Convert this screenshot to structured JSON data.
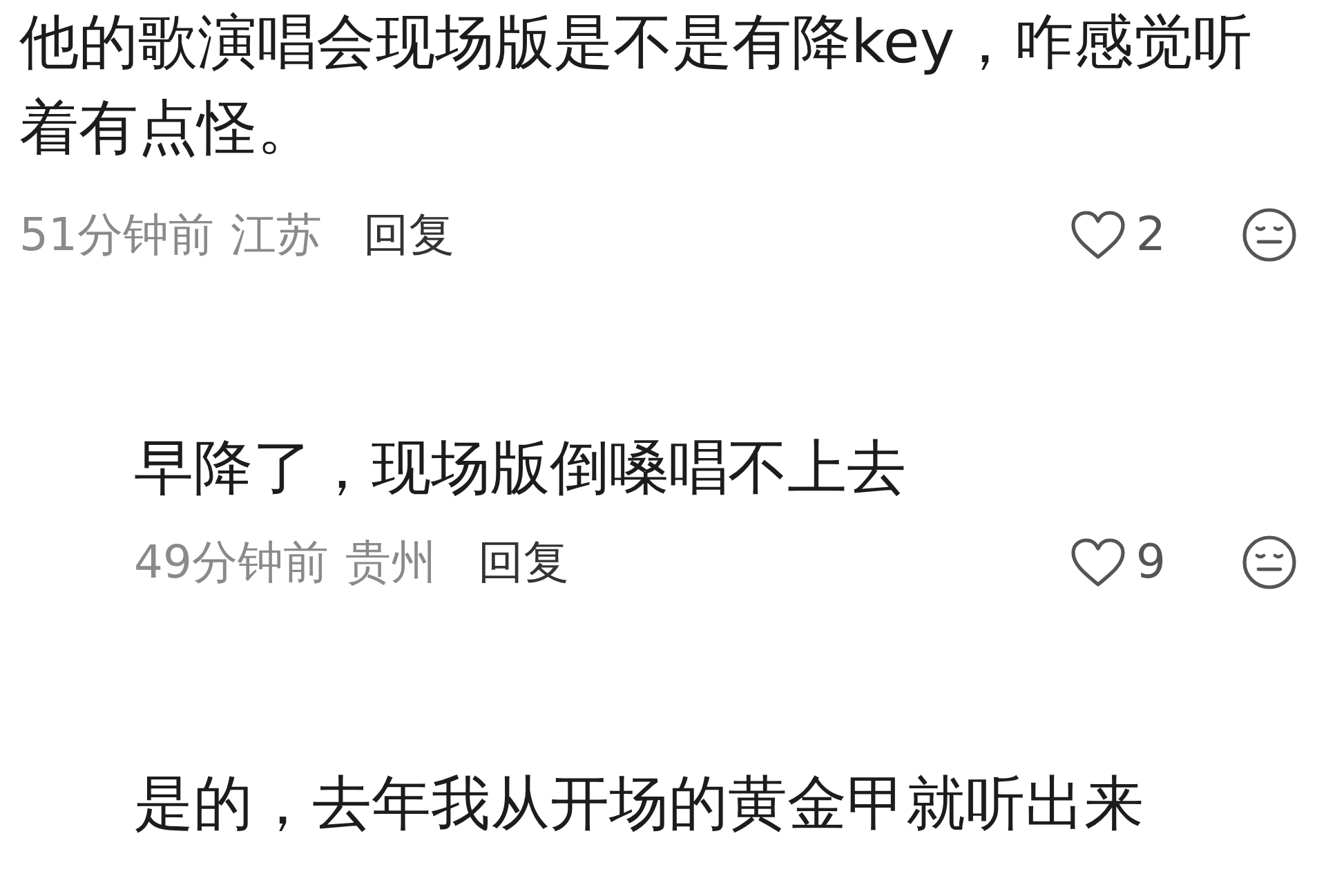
{
  "comments": [
    {
      "kind": "comment",
      "text": "他的歌演唱会现场版是不是有降key，咋感觉听着有点怪。",
      "time": "51分钟前",
      "location": "江苏",
      "reply": "回复",
      "likes": "2"
    },
    {
      "kind": "reply",
      "text": "早降了，现场版倒嗓唱不上去",
      "time": "49分钟前",
      "location": "贵州",
      "reply": "回复",
      "likes": "9"
    },
    {
      "kind": "reply",
      "text": "是的，去年我从开场的黄金甲就听出来"
    }
  ]
}
